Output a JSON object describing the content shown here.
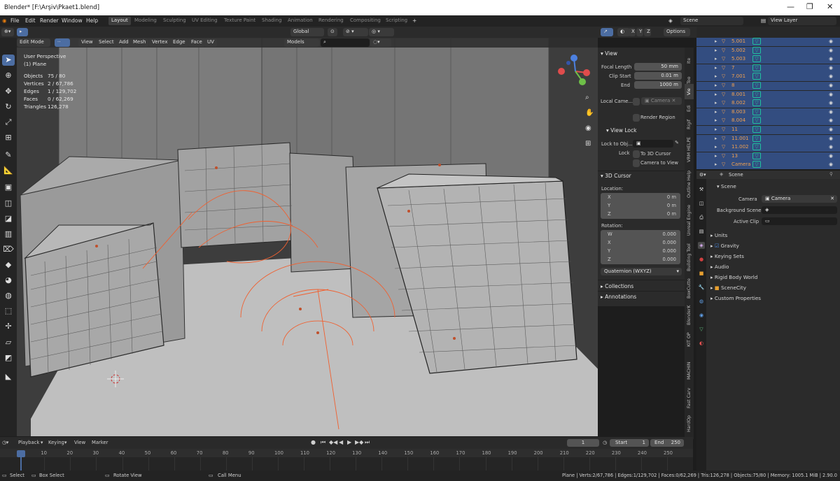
{
  "window": {
    "title": "Blender* [F:\\Arşiv\\Pkaet1.blend]",
    "min": "—",
    "max": "❐",
    "close": "✕"
  },
  "menus": [
    "File",
    "Edit",
    "Render",
    "Window",
    "Help"
  ],
  "workspaces": [
    "Layout",
    "Modeling",
    "Sculpting",
    "UV Editing",
    "Texture Paint",
    "Shading",
    "Animation",
    "Rendering",
    "Compositing",
    "Scripting"
  ],
  "active_workspace": "Layout",
  "scene_field": "Scene",
  "view_layer_field": "View Layer",
  "header": {
    "mode": "Edit Mode",
    "menus": [
      "View",
      "Select",
      "Add",
      "Mesh",
      "Vertex",
      "Edge",
      "Face",
      "UV"
    ],
    "orientation": "Global",
    "models": "Models",
    "options": "Options",
    "axes": [
      "X",
      "Y",
      "Z"
    ]
  },
  "viewport_info": {
    "view": "User Perspective",
    "object": "(1) Plane",
    "stats": [
      {
        "label": "Objects",
        "value": "75 / 80"
      },
      {
        "label": "Vertices",
        "value": "2 / 67,786"
      },
      {
        "label": "Edges",
        "value": "1 / 129,702"
      },
      {
        "label": "Faces",
        "value": "0 / 62,269"
      },
      {
        "label": "Triangles",
        "value": "126,278"
      }
    ]
  },
  "npanel": {
    "view_header": "View",
    "focal_length_label": "Focal Length",
    "focal_length": "50 mm",
    "clip_start_label": "Clip Start",
    "clip_start": "0.01 m",
    "end_label": "End",
    "end": "1000 m",
    "local_camera_label": "Local Came...",
    "local_camera": "Camera",
    "render_region": "Render Region",
    "view_lock_header": "View Lock",
    "lock_to_obj": "Lock to Obj...",
    "lock_label": "Lock",
    "to_3d_cursor": "To 3D Cursor",
    "camera_to_view": "Camera to View",
    "cursor_header": "3D Cursor",
    "location_label": "Location:",
    "location": [
      {
        "axis": "X",
        "value": "0 m"
      },
      {
        "axis": "Y",
        "value": "0 m"
      },
      {
        "axis": "Z",
        "value": "0 m"
      }
    ],
    "rotation_label": "Rotation:",
    "rotation": [
      {
        "axis": "W",
        "value": "0.000"
      },
      {
        "axis": "X",
        "value": "0.000"
      },
      {
        "axis": "Y",
        "value": "0.000"
      },
      {
        "axis": "Z",
        "value": "0.000"
      }
    ],
    "rotation_mode": "Quaternion (WXYZ)",
    "collections": "Collections",
    "annotations": "Annotations"
  },
  "npanel_tabs": [
    "Ite",
    "Too",
    "Vie",
    "Edi",
    "Rigif",
    "VRM HELPE",
    "Outline Help",
    "Unreal Engine",
    "Building Tool",
    "BoxCutte",
    "BlenderK",
    "KIT OP",
    "MACHIN",
    "Fast Carv",
    "HardOp"
  ],
  "active_npanel_tab": "Vie",
  "outliner_items": [
    "5.001",
    "5.002",
    "5.003",
    "7",
    "7.001",
    "8",
    "8.001",
    "8.002",
    "8.003",
    "8.004",
    "11",
    "11.001",
    "11.002",
    "13",
    "Camera"
  ],
  "properties": {
    "scene_name": "Scene",
    "scene_header": "Scene",
    "camera_label": "Camera",
    "camera": "Camera",
    "background_scene_label": "Background Scene",
    "active_clip_label": "Active Clip",
    "sections": [
      "Units",
      "Gravity",
      "Keying Sets",
      "Audio",
      "Rigid Body World",
      "SceneCity",
      "Custom Properties"
    ]
  },
  "timeline": {
    "menus": [
      "Playback",
      "Keying",
      "View",
      "Marker"
    ],
    "current_frame": "1",
    "start_label": "Start",
    "start": "1",
    "end_label": "End",
    "end": "250",
    "ticks": [
      "1",
      "10",
      "20",
      "30",
      "40",
      "50",
      "60",
      "70",
      "80",
      "90",
      "100",
      "110",
      "120",
      "130",
      "140",
      "150",
      "160",
      "170",
      "180",
      "190",
      "200",
      "210",
      "220",
      "230",
      "240",
      "250"
    ]
  },
  "statusbar": {
    "select": "Select",
    "box_select": "Box Select",
    "rotate_view": "Rotate View",
    "call_menu": "Call Menu",
    "stats": "Plane | Verts:2/67,786 | Edges:1/129,702 | Faces:0/62,269 | Tris:126,278 | Objects:75/80 | Memory: 1005.1 MiB | 2.90.0"
  },
  "colors": {
    "accent": "#4c6da2",
    "outliner_sel": "#334d80",
    "object_orange": "#f0a050",
    "wire": "#f06030"
  }
}
